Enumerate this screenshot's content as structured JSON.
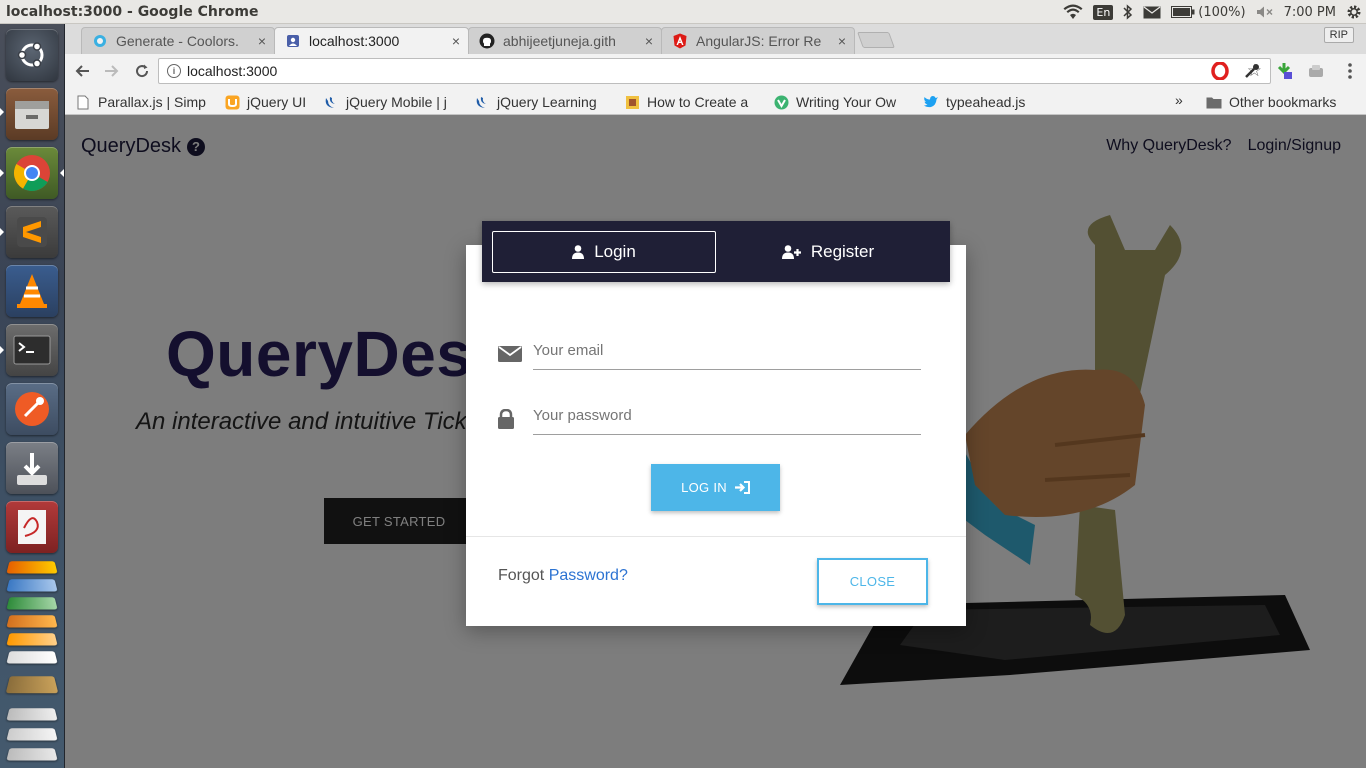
{
  "system": {
    "window_title": "localhost:3000 - Google Chrome",
    "language": "En",
    "battery": "(100%)",
    "time": "7:00 PM"
  },
  "browser": {
    "tabs": [
      {
        "label": "Generate - Coolors.",
        "close": "×"
      },
      {
        "label": "localhost:3000",
        "close": "×"
      },
      {
        "label": "abhijeetjuneja.gith",
        "close": "×"
      },
      {
        "label": "AngularJS: Error Re",
        "close": "×"
      }
    ],
    "rip_label": "RIP",
    "url": "localhost:3000",
    "bookmarks": [
      "Parallax.js | Simp",
      "jQuery UI",
      "jQuery Mobile | j",
      "jQuery Learning",
      "How to Create a",
      "Writing Your Ow",
      "typeahead.js"
    ],
    "bookmarks_more": "»",
    "other_bookmarks": "Other bookmarks"
  },
  "page": {
    "brand": "QueryDesk",
    "nav": [
      "Why QueryDesk?",
      "Login/Signup"
    ],
    "hero_title": "QueryDesk",
    "hero_subtitle": "An interactive and intuitive Ticketing System",
    "cta": "GET STARTED"
  },
  "modal": {
    "tab_login": "Login",
    "tab_register": "Register",
    "email_placeholder": "Your email",
    "password_placeholder": "Your password",
    "login_button": "LOG IN",
    "forgot_prefix": "Forgot",
    "forgot_link": "Password?",
    "close_button": "CLOSE"
  },
  "colors": {
    "accent": "#4db6e8",
    "modal_header": "#1f1f36",
    "brand_text": "#281e5d"
  }
}
